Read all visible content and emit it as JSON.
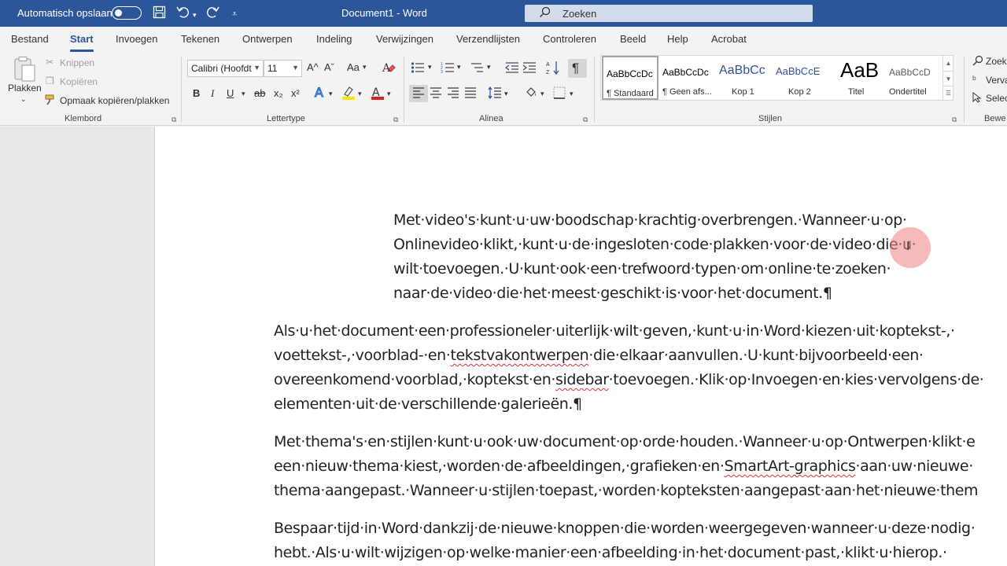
{
  "titlebar": {
    "autosave_label": "Automatisch opslaan",
    "document_title": "Document1  -  Word",
    "search_placeholder": "Zoeken"
  },
  "menu": {
    "tabs": [
      "Bestand",
      "Start",
      "Invoegen",
      "Tekenen",
      "Ontwerpen",
      "Indeling",
      "Verwijzingen",
      "Verzendlijsten",
      "Controleren",
      "Beeld",
      "Help",
      "Acrobat"
    ],
    "active": "Start"
  },
  "ribbon": {
    "clipboard": {
      "label": "Klembord",
      "paste": "Plakken",
      "cut": "Knippen",
      "copy": "Kopiëren",
      "format_painter": "Opmaak kopiëren/plakken"
    },
    "font": {
      "label": "Lettertype",
      "font_name": "Calibri (Hoofdt",
      "font_size": "11",
      "bold": "B",
      "italic": "I",
      "underline": "U",
      "strike": "ab",
      "subscript": "x₂",
      "superscript": "x²",
      "grow": "A^",
      "shrink": "Aˇ",
      "case": "Aa"
    },
    "paragraph": {
      "label": "Alinea"
    },
    "styles": {
      "label": "Stijlen",
      "items": [
        {
          "sample": "AaBbCcDc",
          "name": "¶ Standaard"
        },
        {
          "sample": "AaBbCcDc",
          "name": "¶ Geen afs..."
        },
        {
          "sample": "AaBbCc",
          "name": "Kop 1"
        },
        {
          "sample": "AaBbCcE",
          "name": "Kop 2"
        },
        {
          "sample": "AaB",
          "name": "Titel"
        },
        {
          "sample": "AaBbCcD",
          "name": "Ondertitel"
        }
      ]
    },
    "editing": {
      "label": "Bewe",
      "find": "Zoek",
      "replace": "Verva",
      "select": "Selec"
    }
  },
  "document": {
    "paragraphs": [
      {
        "lines": [
          "Met·video's·kunt·u·uw·boodschap·krachtig·overbrengen.·Wanneer·u·op·",
          "Onlinevideo·klikt,·kunt·u·de·ingesloten·code·plakken·voor·de·video·die·u·",
          "wilt·toevoegen.·U·kunt·ook·een·trefwoord·typen·om·online·te·zoeken·",
          "naar·de·video·die·het·meest·geschikt·is·voor·het·document.¶"
        ]
      },
      {
        "lines": [
          "Als·u·het·document·een·professioneler·uiterlijk·wilt·geven,·kunt·u·in·Word·kiezen·uit·koptekst-,·",
          "voettekst-,·voorblad-·en·tekstvakontwerpen·die·elkaar·aanvullen.·U·kunt·bijvoorbeeld·een·",
          "overeenkomend·voorblad,·koptekst·en·sidebar·toevoegen.·Klik·op·Invoegen·en·kies·vervolgens·de·",
          "elementen·uit·de·verschillende·galerieën.¶"
        ]
      },
      {
        "lines": [
          "Met·thema's·en·stijlen·kunt·u·ook·uw·document·op·orde·houden.·Wanneer·u·op·Ontwerpen·klikt·e",
          "een·nieuw·thema·kiest,·worden·de·afbeeldingen,·grafieken·en·SmartArt-graphics·aan·uw·nieuwe·",
          "thema·aangepast.·Wanneer·u·stijlen·toepast,·worden·kopteksten·aangepast·aan·het·nieuwe·them"
        ]
      },
      {
        "lines": [
          "Bespaar·tijd·in·Word·dankzij·de·nieuwe·knoppen·die·worden·weergegeven·wanneer·u·deze·nodig·",
          "hebt.·Als·u·wilt·wijzigen·op·welke·manier·een·afbeelding·in·het·document·past,·klikt·u·hierop.·"
        ]
      }
    ],
    "misspelled": [
      "tekstvakontwerpen",
      "sidebar",
      "SmartArt-graphics"
    ]
  }
}
